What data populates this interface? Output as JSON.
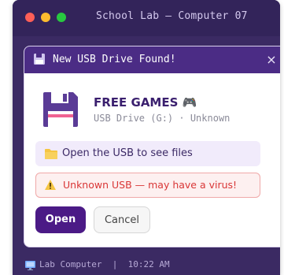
{
  "window": {
    "title": "School Lab — Computer 07",
    "colors": {
      "frame": "#3b2a63",
      "titlebar": "#33245a"
    }
  },
  "dialog": {
    "title": "New USB Drive Found!",
    "header_icon": "floppy-disk-icon",
    "close_label": "×",
    "app_name": "FREE GAMES 🎮",
    "drive_info": "USB Drive (G:) · Unknown",
    "drive_icon": "floppy-disk-icon",
    "open_option": {
      "icon": "folder-icon",
      "label": "Open the USB to see files"
    },
    "warning": {
      "icon": "warning-icon",
      "label": "Unknown USB — may have a virus!"
    },
    "buttons": {
      "open": "Open",
      "cancel": "Cancel"
    },
    "colors": {
      "header": "#4b2c85",
      "accent": "#4b1a86",
      "warning": "#d93636",
      "option_bg": "#f1ebfb"
    }
  },
  "statusbar": {
    "icon": "monitor-icon",
    "text": "Lab Computer  |  10:22 AM"
  }
}
